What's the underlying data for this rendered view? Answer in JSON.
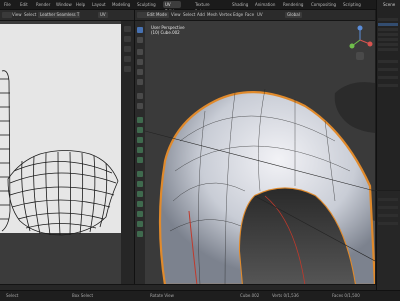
{
  "workspace_tabs": [
    "File",
    "Edit",
    "Render",
    "Window",
    "Help",
    "Layout",
    "Modeling",
    "Sculpting",
    "UV Editing",
    "Texture Paint",
    "Shading",
    "Animation",
    "Rendering",
    "Compositing",
    "Scripting"
  ],
  "active_tab": "UV Editing",
  "scene": {
    "name": "Scene"
  },
  "uv_editor": {
    "mode": "UV Editor",
    "menus": [
      "View",
      "Select",
      "Image",
      "UV"
    ],
    "uv_sync": "UV",
    "image_name": "Leather Seamless T",
    "new_label": "New",
    "image_tab": "Image"
  },
  "viewport": {
    "mode": "Edit Mode",
    "menus": [
      "View",
      "Select",
      "Add",
      "Mesh",
      "Vertex",
      "Edge",
      "Face",
      "UV"
    ],
    "orientation": "Global",
    "info_line1": "User Perspective",
    "info_line2": "(10) Cube.002"
  },
  "status": {
    "left": "Select",
    "mid": "Box Select",
    "mid2": "Rotate View",
    "right1": "Cube.002",
    "right2": "Verts 0/1,536",
    "right3": "Faces 0/1,500"
  },
  "colors": {
    "uv_background": "#e6e6e6",
    "mesh_orange": "#e08a2c",
    "active_tab_bg": "#3d3d3d"
  }
}
